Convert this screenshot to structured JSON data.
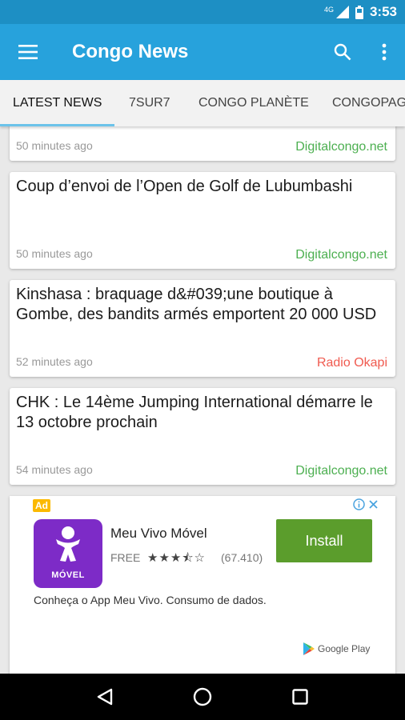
{
  "status_bar": {
    "time": "3:53",
    "network": "4G"
  },
  "app_bar": {
    "title": "Congo News"
  },
  "tabs": [
    {
      "label": "LATEST NEWS",
      "active": true
    },
    {
      "label": "7SUR7",
      "active": false
    },
    {
      "label": "CONGO PLANÈTE",
      "active": false
    },
    {
      "label": "CONGOPAGE",
      "active": false
    }
  ],
  "articles": [
    {
      "title": "",
      "time": "50 minutes ago",
      "source": "Digitalcongo.net",
      "source_color": "#4caf50"
    },
    {
      "title": "Coup d’envoi de l’Open de Golf de Lubumbashi",
      "time": "50 minutes ago",
      "source": "Digitalcongo.net",
      "source_color": "#4caf50"
    },
    {
      "title": "Kinshasa : braquage d&#039;une boutique à Gombe, des bandits armés emportent 20 000 USD",
      "time": "52 minutes ago",
      "source": "Radio Okapi",
      "source_color": "#f05a4f"
    },
    {
      "title": "CHK : Le 14ème Jumping International démarre le 13 octobre prochain",
      "time": "54 minutes ago",
      "source": "Digitalcongo.net",
      "source_color": "#4caf50"
    }
  ],
  "ad": {
    "badge": "Ad",
    "app_name": "Meu Vivo Móvel",
    "brand_text": "MÓVEL",
    "price": "FREE",
    "stars": "★★★⯪☆",
    "rating_count": "(67.410)",
    "install_label": "Install",
    "description": "Conheça o App Meu Vivo. Consumo de dados.",
    "store_label": "Google Play"
  },
  "colors": {
    "status_bar": "#1d8fc4",
    "app_bar": "#27a2dc",
    "tab_indicator": "#6cc3ea",
    "install": "#5b9d2c",
    "ad_icon": "#7d2bc7"
  },
  "icons": [
    "menu-icon",
    "search-icon",
    "more-vert-icon",
    "back-icon",
    "home-icon",
    "recents-icon"
  ]
}
